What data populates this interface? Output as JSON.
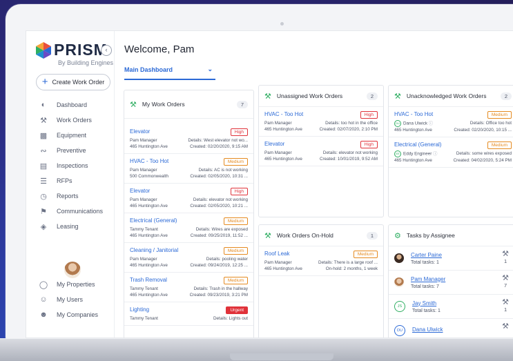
{
  "app": {
    "logo_text": "PRISM",
    "logo_sub": "By Building Engines",
    "welcome": "Welcome, Pam",
    "dashboard_select": "Main Dashboard",
    "create_button": "Create Work Order"
  },
  "sidebar": {
    "items": [
      {
        "label": "Dashboard",
        "icon": "dashboard-icon"
      },
      {
        "label": "Work Orders",
        "icon": "wrench-icon"
      },
      {
        "label": "Equipment",
        "icon": "equipment-icon"
      },
      {
        "label": "Preventive",
        "icon": "preventive-icon"
      },
      {
        "label": "Inspections",
        "icon": "clipboard-icon"
      },
      {
        "label": "RFPs",
        "icon": "list-icon"
      },
      {
        "label": "Reports",
        "icon": "reports-icon"
      },
      {
        "label": "Communications",
        "icon": "megaphone-icon"
      },
      {
        "label": "Leasing",
        "icon": "layers-icon"
      }
    ],
    "bottom_items": [
      {
        "label": "My Properties",
        "icon": "globe-icon"
      },
      {
        "label": "My Users",
        "icon": "users-icon"
      },
      {
        "label": "My Companies",
        "icon": "companies-icon"
      }
    ]
  },
  "my_work_orders": {
    "title": "My Work Orders",
    "count": "7",
    "items": [
      {
        "title": "Elevator",
        "priority": "High",
        "person": "Pam Manager",
        "details": "Details: West elevator not wo...",
        "address": "465 Huntington Ave",
        "created": "Created: 02/20/2020, 9:15 AM"
      },
      {
        "title": "HVAC - Too Hot",
        "priority": "Medium",
        "person": "Pam Manager",
        "details": "Details: AC is not working",
        "address": "500 Commonwealth",
        "created": "Created: 02/05/2020, 10:31 ..."
      },
      {
        "title": "Elevator",
        "priority": "High",
        "person": "Pam Manager",
        "details": "Details: elevator not working",
        "address": "465 Huntington Ave",
        "created": "Created: 02/05/2020, 10:21 ..."
      },
      {
        "title": "Electrical (General)",
        "priority": "Medium",
        "person": "Tammy Tenant",
        "details": "Details: Wires are exposed",
        "address": "465 Huntington Ave",
        "created": "Created: 09/25/2019, 11:52 ..."
      },
      {
        "title": "Cleaning / Janitorial",
        "priority": "Medium",
        "person": "Pam Manager",
        "details": "Details: pooling water",
        "address": "465 Huntington Ave",
        "created": "Created: 09/24/2019, 12:25 ..."
      },
      {
        "title": "Trash Removal",
        "priority": "Medium",
        "person": "Tammy Tenant",
        "details": "Details: Trash in the hallway",
        "address": "465 Huntington Ave",
        "created": "Created: 09/23/2019, 3:21 PM"
      },
      {
        "title": "Lighting",
        "priority": "Urgent",
        "person": "Tammy Tenant",
        "details": "Details: Lights out",
        "address": "",
        "created": ""
      }
    ]
  },
  "unassigned": {
    "title": "Unassigned Work Orders",
    "count": "2",
    "items": [
      {
        "title": "HVAC - Too Hot",
        "priority": "High",
        "person": "Pam Manager",
        "details": "Details: too hot in the office",
        "address": "465 Huntington Ave",
        "created": "Created: 02/07/2020, 2:10 PM"
      },
      {
        "title": "Elevator",
        "priority": "High",
        "person": "Pam Manager",
        "details": "Details: elevator not working",
        "address": "465 Huntington Ave",
        "created": "Created: 10/01/2019, 9:52 AM"
      }
    ]
  },
  "unacknowledged": {
    "title": "Unacknowledged Work Orders",
    "count": "2",
    "items": [
      {
        "title": "HVAC - Too Hot",
        "priority": "Medium",
        "initials": "DU",
        "person": "Dana Ulwick",
        "details": "Details: Office too hot",
        "address": "465 Huntington Ave",
        "created": "Created: 02/20/2020, 10:15 ..."
      },
      {
        "title": "Electrical (General)",
        "priority": "Medium",
        "initials": "EE",
        "person": "Eddy Engineer",
        "details": "Details: some wires exposed",
        "address": "465 Huntington Ave",
        "created": "Created: 04/02/2020, 5:24 PM"
      }
    ]
  },
  "on_hold": {
    "title": "Work Orders On-Hold",
    "count": "1",
    "items": [
      {
        "title": "Roof Leak",
        "priority": "Medium",
        "person": "Pam Manager",
        "details": "Details: There is a large roof ...",
        "address": "465 Huntington Ave",
        "created": "On-hold: 2 months, 1 week"
      }
    ]
  },
  "tasks": {
    "title": "Tasks by Assignee",
    "items": [
      {
        "name": "Carter Paine",
        "total_label": "Total tasks:",
        "total": "1",
        "count": "1",
        "initials": ""
      },
      {
        "name": "Pam Manager",
        "total_label": "Total tasks:",
        "total": "7",
        "count": "7",
        "initials": ""
      },
      {
        "name": "Jay Smith",
        "total_label": "Total tasks:",
        "total": "1",
        "count": "1",
        "initials": "JS"
      },
      {
        "name": "Dana Ulwick",
        "total_label": "",
        "total": "",
        "count": "",
        "initials": "DU"
      }
    ]
  },
  "colors": {
    "accent": "#2b69d6",
    "green": "#2fae62",
    "high": "#e0323a",
    "medium": "#e58a1f"
  }
}
